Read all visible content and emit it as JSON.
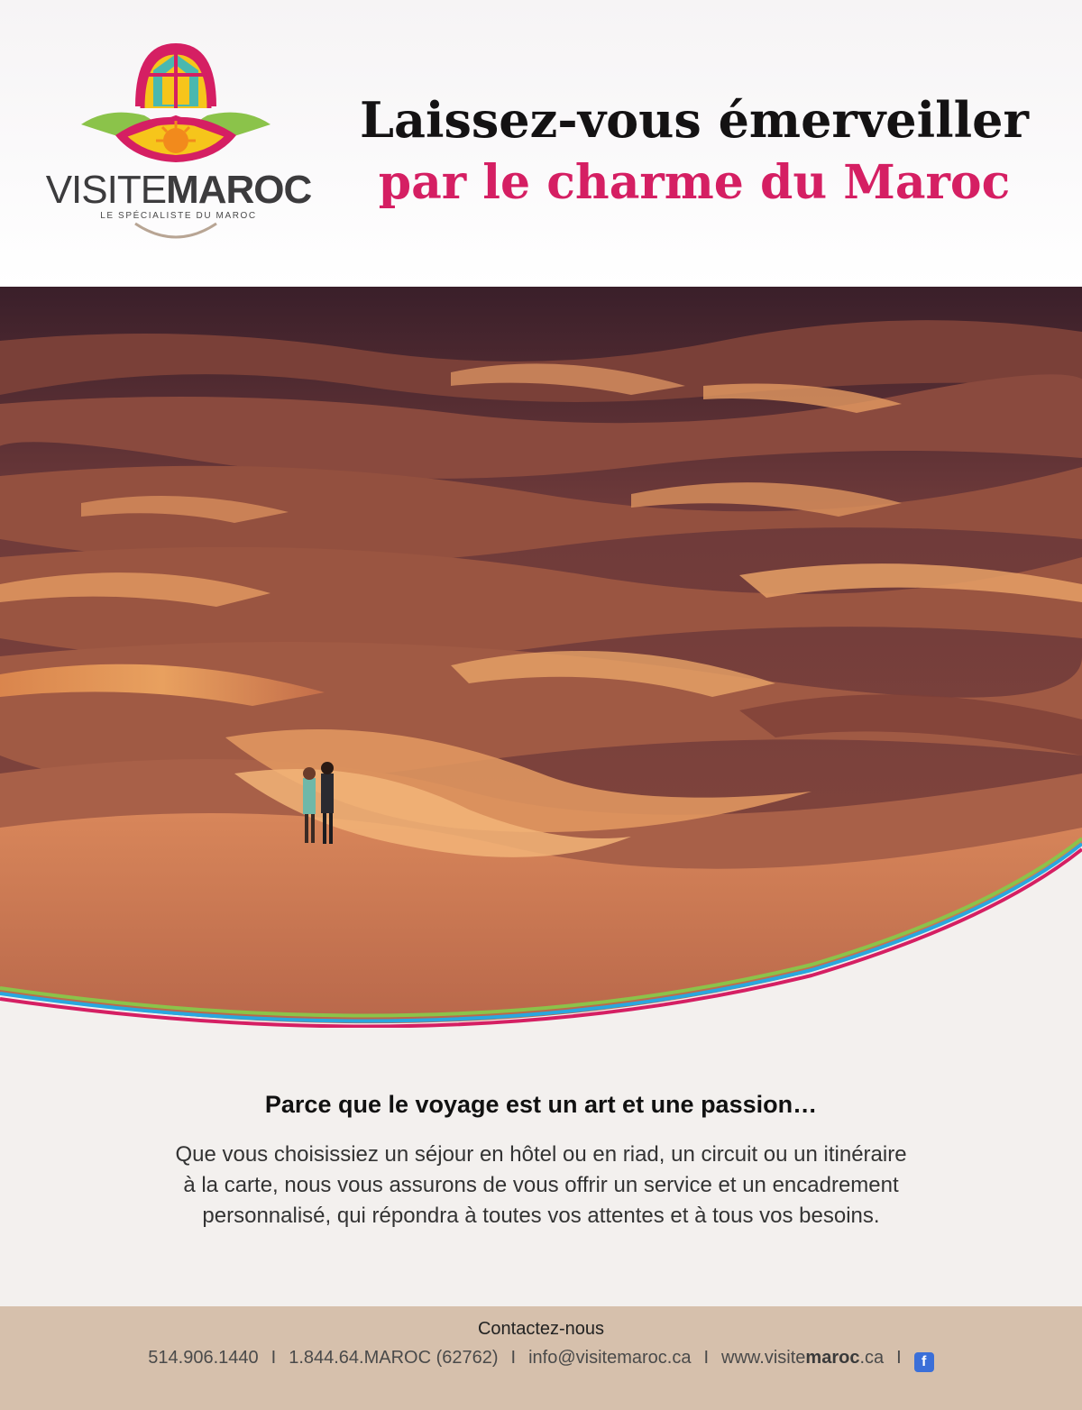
{
  "brand": {
    "name_light": "VISITE",
    "name_bold": "MAROC",
    "tagline": "LE SPÉCIALISTE DU MAROC"
  },
  "headline": {
    "line1": "Laissez-vous émerveiller",
    "line2": "par le charme du Maroc"
  },
  "body": {
    "lead": "Parce que le voyage est un art et une passion…",
    "lines": [
      "Que vous choisissiez un séjour en hôtel ou en riad, un circuit ou un itinéraire",
      "à la carte, nous vous assurons de vous offrir un service et un encadrement",
      "personnalisé, qui répondra à toutes vos attentes et à tous vos besoins."
    ]
  },
  "footer": {
    "title": "Contactez-nous",
    "phone1": "514.906.1440",
    "phone2": "1.844.64.MAROC (62762)",
    "email": "info@visitemaroc.ca",
    "site_prefix": "www.visite",
    "site_bold": "maroc",
    "site_suffix": ".ca",
    "separator": "I",
    "facebook_icon": "f"
  },
  "colors": {
    "accent_pink": "#d51f63",
    "footer_bg": "#d6c0ac",
    "wave_green": "#8bc34a",
    "wave_blue": "#29a7df",
    "wave_magenta": "#d51f63"
  }
}
